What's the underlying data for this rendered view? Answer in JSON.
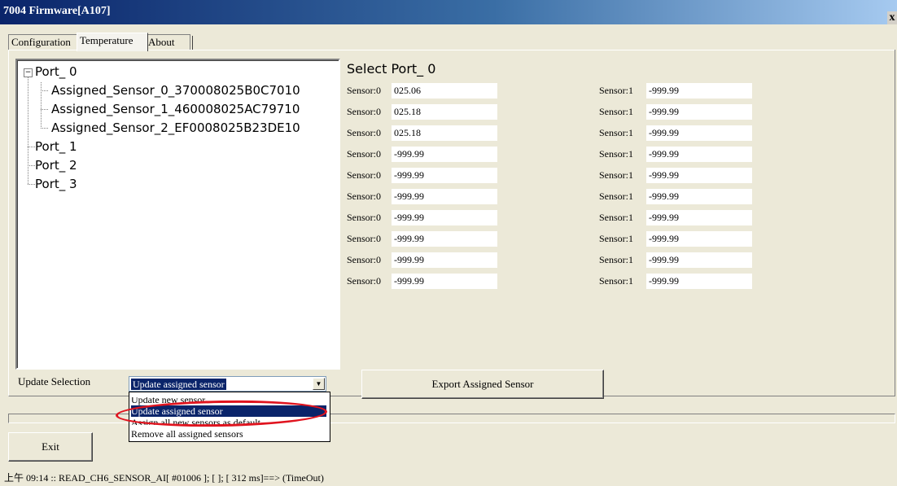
{
  "window": {
    "title": "7004 Firmware[A107]",
    "close_label": "x"
  },
  "tabs": [
    "Configuration",
    "Temperature",
    "About"
  ],
  "tree": {
    "expander": "−",
    "root": "Port_ 0",
    "children": [
      "Assigned_Sensor_0_370008025B0C7010",
      "Assigned_Sensor_1_460008025AC79710",
      "Assigned_Sensor_2_EF0008025B23DE10"
    ],
    "ports": [
      "Port_ 1",
      "Port_ 2",
      "Port_ 3"
    ]
  },
  "select_port_title": "Select Port_ 0",
  "sensors": {
    "left_label": "Sensor:0",
    "right_label": "Sensor:1",
    "left_values": [
      "025.06",
      "025.18",
      "025.18",
      "-999.99",
      "-999.99",
      "-999.99",
      "-999.99",
      "-999.99",
      "-999.99",
      "-999.99"
    ],
    "right_values": [
      "-999.99",
      "-999.99",
      "-999.99",
      "-999.99",
      "-999.99",
      "-999.99",
      "-999.99",
      "-999.99",
      "-999.99",
      "-999.99"
    ]
  },
  "update_selection": {
    "label": "Update Selection",
    "selected": "Update assigned sensor",
    "options": [
      "Update new sensor",
      "Update assigned sensor",
      "Assign all new sensors as default",
      "Remove all assigned sensors"
    ]
  },
  "export_button": "Export Assigned Sensor",
  "exit_button": "Exit",
  "status": "上午 09:14 :: READ_CH6_SENSOR_AI[ #01006 ]; [ ]; [ 312 ms]==> (TimeOut)",
  "colors": {
    "highlight": "#0a246a",
    "annotation": "#e0141f"
  }
}
